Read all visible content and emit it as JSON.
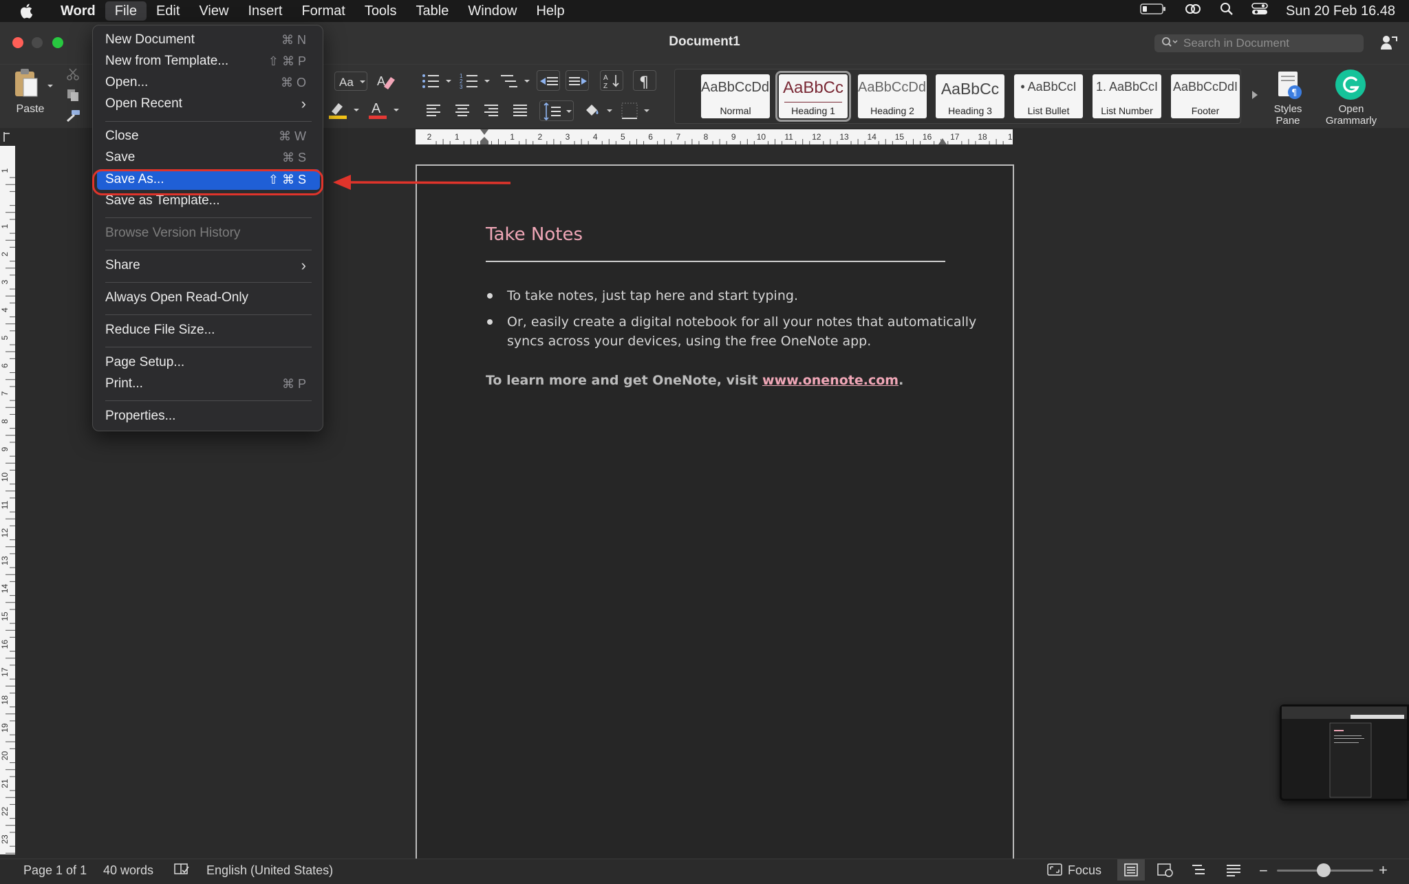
{
  "menubar": {
    "items": [
      "Word",
      "File",
      "Edit",
      "View",
      "Insert",
      "Format",
      "Tools",
      "Table",
      "Window",
      "Help"
    ],
    "datetime": "Sun 20 Feb  16.48"
  },
  "window": {
    "title": "Document1",
    "search_placeholder": "Search in Document"
  },
  "ribbon": {
    "paste_label": "Paste",
    "styles": [
      {
        "sample": "AaBbCcDdI",
        "label": "Normal"
      },
      {
        "sample": "AaBbCc",
        "label": "Heading 1"
      },
      {
        "sample": "AaBbCcDdI",
        "label": "Heading 2"
      },
      {
        "sample": "AaBbCc",
        "label": "Heading 3"
      },
      {
        "sample": "• AaBbCcI",
        "label": "List Bullet"
      },
      {
        "sample": "1. AaBbCcI",
        "label": "List Number"
      },
      {
        "sample": "AaBbCcDdI",
        "label": "Footer"
      }
    ],
    "styles_pane_label": "Styles\nPane",
    "grammarly_label": "Open\nGrammarly",
    "colors": {
      "highlight": "#f5c518",
      "font_color": "#e53935",
      "grammarly": "#15c39a"
    }
  },
  "ruler": {
    "h_numbers": [
      "2",
      "1",
      "",
      "1",
      "2",
      "3",
      "4",
      "5",
      "6",
      "7",
      "8",
      "9",
      "10",
      "11",
      "12",
      "13",
      "14",
      "15",
      "16",
      "17",
      "18",
      "1"
    ],
    "v_numbers": [
      "1",
      "",
      "1",
      "2",
      "3",
      "4",
      "5",
      "6",
      "7",
      "8",
      "9",
      "10",
      "11",
      "12",
      "13",
      "14",
      "15",
      "16",
      "17",
      "18",
      "19",
      "20",
      "21",
      "22",
      "23"
    ]
  },
  "document": {
    "heading": "Take Notes",
    "bullets": [
      "To take notes, just tap here and start typing.",
      "Or, easily create a digital notebook for all your notes that automatically",
      "syncs across your devices, using the free OneNote app."
    ],
    "learn_prefix": "To learn more and get OneNote, visit ",
    "learn_link": "www.onenote.com",
    "learn_suffix": "."
  },
  "file_menu": {
    "items": [
      {
        "label": "New Document",
        "shortcut": "⌘ N"
      },
      {
        "label": "New from Template...",
        "shortcut": "⇧ ⌘ P"
      },
      {
        "label": "Open...",
        "shortcut": "⌘ O"
      },
      {
        "label": "Open Recent",
        "shortcut": "›"
      },
      {
        "label": "Close",
        "shortcut": "⌘ W"
      },
      {
        "label": "Save",
        "shortcut": "⌘ S"
      },
      {
        "label": "Save As...",
        "shortcut": "⇧ ⌘ S"
      },
      {
        "label": "Save as Template...",
        "shortcut": ""
      },
      {
        "label": "Browse Version History",
        "shortcut": ""
      },
      {
        "label": "Share",
        "shortcut": "›"
      },
      {
        "label": "Always Open Read-Only",
        "shortcut": ""
      },
      {
        "label": "Reduce File Size...",
        "shortcut": ""
      },
      {
        "label": "Page Setup...",
        "shortcut": ""
      },
      {
        "label": "Print...",
        "shortcut": "⌘ P"
      },
      {
        "label": "Properties...",
        "shortcut": ""
      }
    ]
  },
  "statusbar": {
    "page": "Page 1 of 1",
    "words": "40 words",
    "language": "English (United States)",
    "focus": "Focus"
  },
  "annotation": {
    "color": "#e0342b"
  }
}
